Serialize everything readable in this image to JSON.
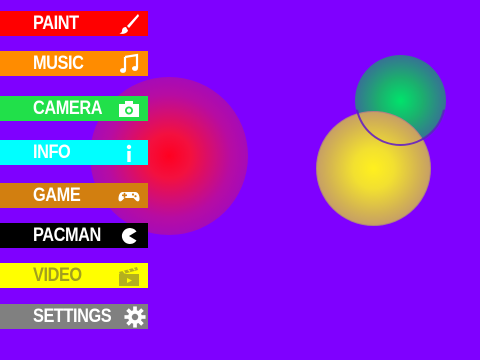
{
  "colors": {
    "background": "#7f00ff",
    "paint": "#ff0000",
    "music": "#ff8c00",
    "camera": "#21e04a",
    "info": "#00ffff",
    "game": "#d27f10",
    "pacman": "#000000",
    "video": "#ffff00",
    "settings": "#808080",
    "label_text": "#ffffff",
    "video_label_text": "#a29f1e"
  },
  "menu": {
    "items": [
      {
        "label": "PAINT",
        "icon": "paintbrush-icon",
        "color": "#ff0000"
      },
      {
        "label": "MUSIC",
        "icon": "music-note-icon",
        "color": "#ff8c00"
      },
      {
        "label": "CAMERA",
        "icon": "camera-icon",
        "color": "#21e04a"
      },
      {
        "label": "INFO",
        "icon": "info-icon",
        "color": "#00ffff"
      },
      {
        "label": "GAME",
        "icon": "gamepad-icon",
        "color": "#d27f10"
      },
      {
        "label": "PACMAN",
        "icon": "pacman-icon",
        "color": "#000000"
      },
      {
        "label": "VIDEO",
        "icon": "clapperboard-icon",
        "color": "#ffff00"
      },
      {
        "label": "SETTINGS",
        "icon": "gear-icon",
        "color": "#808080"
      }
    ]
  },
  "orbs": {
    "red": "#ff0020",
    "green": "#00e36b",
    "yellow": "#fff01e"
  }
}
